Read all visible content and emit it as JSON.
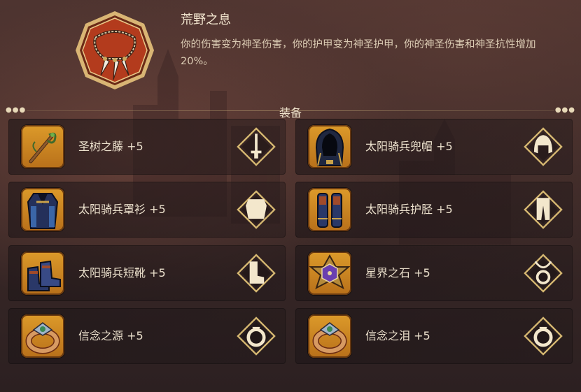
{
  "set": {
    "title": "荒野之息",
    "description": "你的伤害变为神圣伤害，你的护甲变为神圣护甲，你的神圣伤害和神圣抗性增加20%。",
    "emblem_icon": "fang-necklace-icon"
  },
  "section": {
    "title": "装备"
  },
  "colors": {
    "emblem_red": "#b03a1c",
    "emblem_gold": "#e6c27a",
    "item_orange": "#d3901f",
    "text_light": "#ebe0cc"
  },
  "equipment": [
    {
      "name": "圣树之藤 +5",
      "item_icon": "vine-staff-icon",
      "slot_icon": "weapon-slot-icon"
    },
    {
      "name": "太阳骑兵兜帽 +5",
      "item_icon": "hood-icon",
      "slot_icon": "helmet-slot-icon"
    },
    {
      "name": "太阳骑兵罩衫 +5",
      "item_icon": "tunic-icon",
      "slot_icon": "chest-slot-icon"
    },
    {
      "name": "太阳骑兵护胫 +5",
      "item_icon": "greaves-icon",
      "slot_icon": "legs-slot-icon"
    },
    {
      "name": "太阳骑兵短靴 +5",
      "item_icon": "boots-icon",
      "slot_icon": "boots-slot-icon"
    },
    {
      "name": "星界之石 +5",
      "item_icon": "star-stone-icon",
      "slot_icon": "amulet-slot-icon"
    },
    {
      "name": "信念之源 +5",
      "item_icon": "ring-icon",
      "slot_icon": "ring-slot-icon"
    },
    {
      "name": "信念之泪 +5",
      "item_icon": "ring-icon",
      "slot_icon": "ring-slot-icon"
    }
  ]
}
